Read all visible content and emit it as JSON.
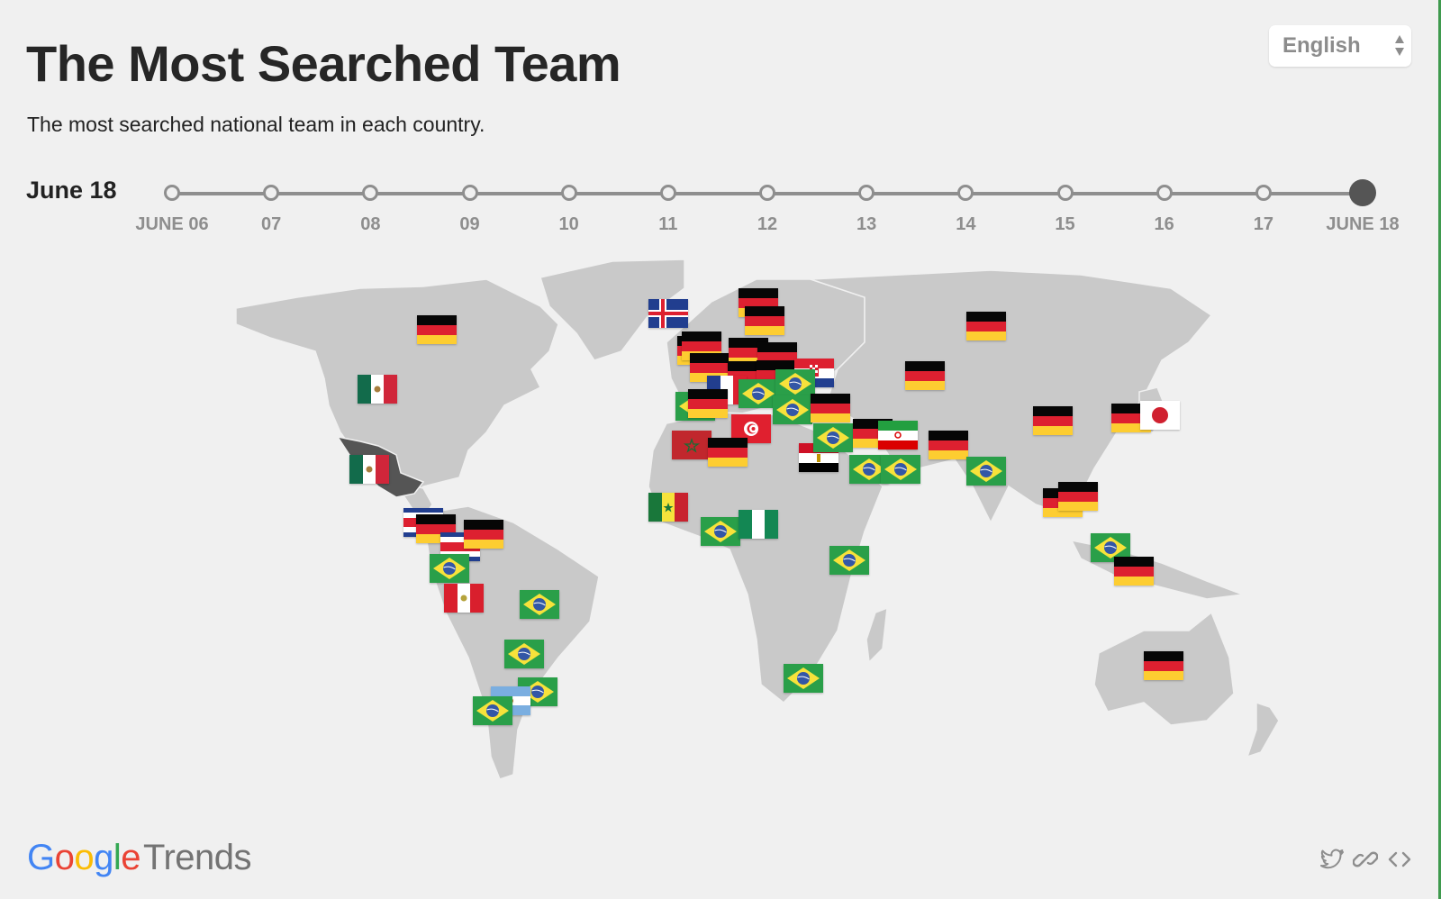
{
  "header": {
    "title": "The Most Searched Team",
    "subtitle": "The most searched national team in each country."
  },
  "language_select": {
    "value": "English"
  },
  "timeline": {
    "current_label": "June 18",
    "ticks": [
      "JUNE 06",
      "07",
      "08",
      "09",
      "10",
      "11",
      "12",
      "13",
      "14",
      "15",
      "16",
      "17",
      "JUNE 18"
    ],
    "active_index": 12
  },
  "map": {
    "highlighted_country": "Mexico",
    "flags": [
      {
        "team": "Germany",
        "country": "Canada"
      },
      {
        "team": "Mexico",
        "country": "United States"
      },
      {
        "team": "Mexico",
        "country": "Mexico"
      },
      {
        "team": "Costa Rica",
        "country": "Guatemala"
      },
      {
        "team": "Germany",
        "country": "Honduras"
      },
      {
        "team": "Costa Rica",
        "country": "Costa Rica"
      },
      {
        "team": "Germany",
        "country": "Venezuela"
      },
      {
        "team": "Brazil",
        "country": "Ecuador"
      },
      {
        "team": "Peru",
        "country": "Peru"
      },
      {
        "team": "Brazil",
        "country": "Brazil"
      },
      {
        "team": "Brazil",
        "country": "Paraguay"
      },
      {
        "team": "Brazil",
        "country": "Uruguay"
      },
      {
        "team": "Argentina",
        "country": "Argentina"
      },
      {
        "team": "Brazil",
        "country": "Chile"
      },
      {
        "team": "Iceland",
        "country": "Iceland"
      },
      {
        "team": "Germany",
        "country": "Norway"
      },
      {
        "team": "Germany",
        "country": "Sweden"
      },
      {
        "team": "Germany",
        "country": "Ireland"
      },
      {
        "team": "Germany",
        "country": "United Kingdom"
      },
      {
        "team": "Germany",
        "country": "Belgium"
      },
      {
        "team": "Germany",
        "country": "Netherlands"
      },
      {
        "team": "Germany",
        "country": "Germany"
      },
      {
        "team": "Germany",
        "country": "Poland"
      },
      {
        "team": "Germany",
        "country": "Austria"
      },
      {
        "team": "France",
        "country": "France"
      },
      {
        "team": "Croatia",
        "country": "Croatia"
      },
      {
        "team": "Brazil",
        "country": "Italy"
      },
      {
        "team": "Brazil",
        "country": "Serbia"
      },
      {
        "team": "Brazil",
        "country": "Portugal"
      },
      {
        "team": "Germany",
        "country": "Spain"
      },
      {
        "team": "Brazil",
        "country": "Greece"
      },
      {
        "team": "Germany",
        "country": "Turkey"
      },
      {
        "team": "Tunisia",
        "country": "Tunisia"
      },
      {
        "team": "Morocco",
        "country": "Morocco"
      },
      {
        "team": "Germany",
        "country": "Algeria"
      },
      {
        "team": "Egypt",
        "country": "Egypt"
      },
      {
        "team": "Brazil",
        "country": "Jordan"
      },
      {
        "team": "Germany",
        "country": "Iraq"
      },
      {
        "team": "Iran",
        "country": "Iran"
      },
      {
        "team": "Brazil",
        "country": "Saudi Arabia"
      },
      {
        "team": "Brazil",
        "country": "UAE"
      },
      {
        "team": "Germany",
        "country": "Russia"
      },
      {
        "team": "Germany",
        "country": "Kazakhstan"
      },
      {
        "team": "Germany",
        "country": "Pakistan"
      },
      {
        "team": "Brazil",
        "country": "India"
      },
      {
        "team": "Germany",
        "country": "China"
      },
      {
        "team": "Germany",
        "country": "South Korea"
      },
      {
        "team": "Japan",
        "country": "Japan"
      },
      {
        "team": "Germany",
        "country": "Thailand"
      },
      {
        "team": "Germany",
        "country": "Vietnam"
      },
      {
        "team": "Brazil",
        "country": "Malaysia"
      },
      {
        "team": "Germany",
        "country": "Indonesia"
      },
      {
        "team": "Germany",
        "country": "Australia"
      },
      {
        "team": "Senegal",
        "country": "Senegal"
      },
      {
        "team": "Brazil",
        "country": "Ghana"
      },
      {
        "team": "Nigeria",
        "country": "Nigeria"
      },
      {
        "team": "Brazil",
        "country": "Kenya"
      },
      {
        "team": "Brazil",
        "country": "South Africa"
      }
    ]
  },
  "footer": {
    "logo_google": [
      "G",
      "o",
      "o",
      "g",
      "l",
      "e"
    ],
    "logo_product": "Trends",
    "share_icons": [
      "twitter-icon",
      "link-icon",
      "embed-icon"
    ]
  }
}
